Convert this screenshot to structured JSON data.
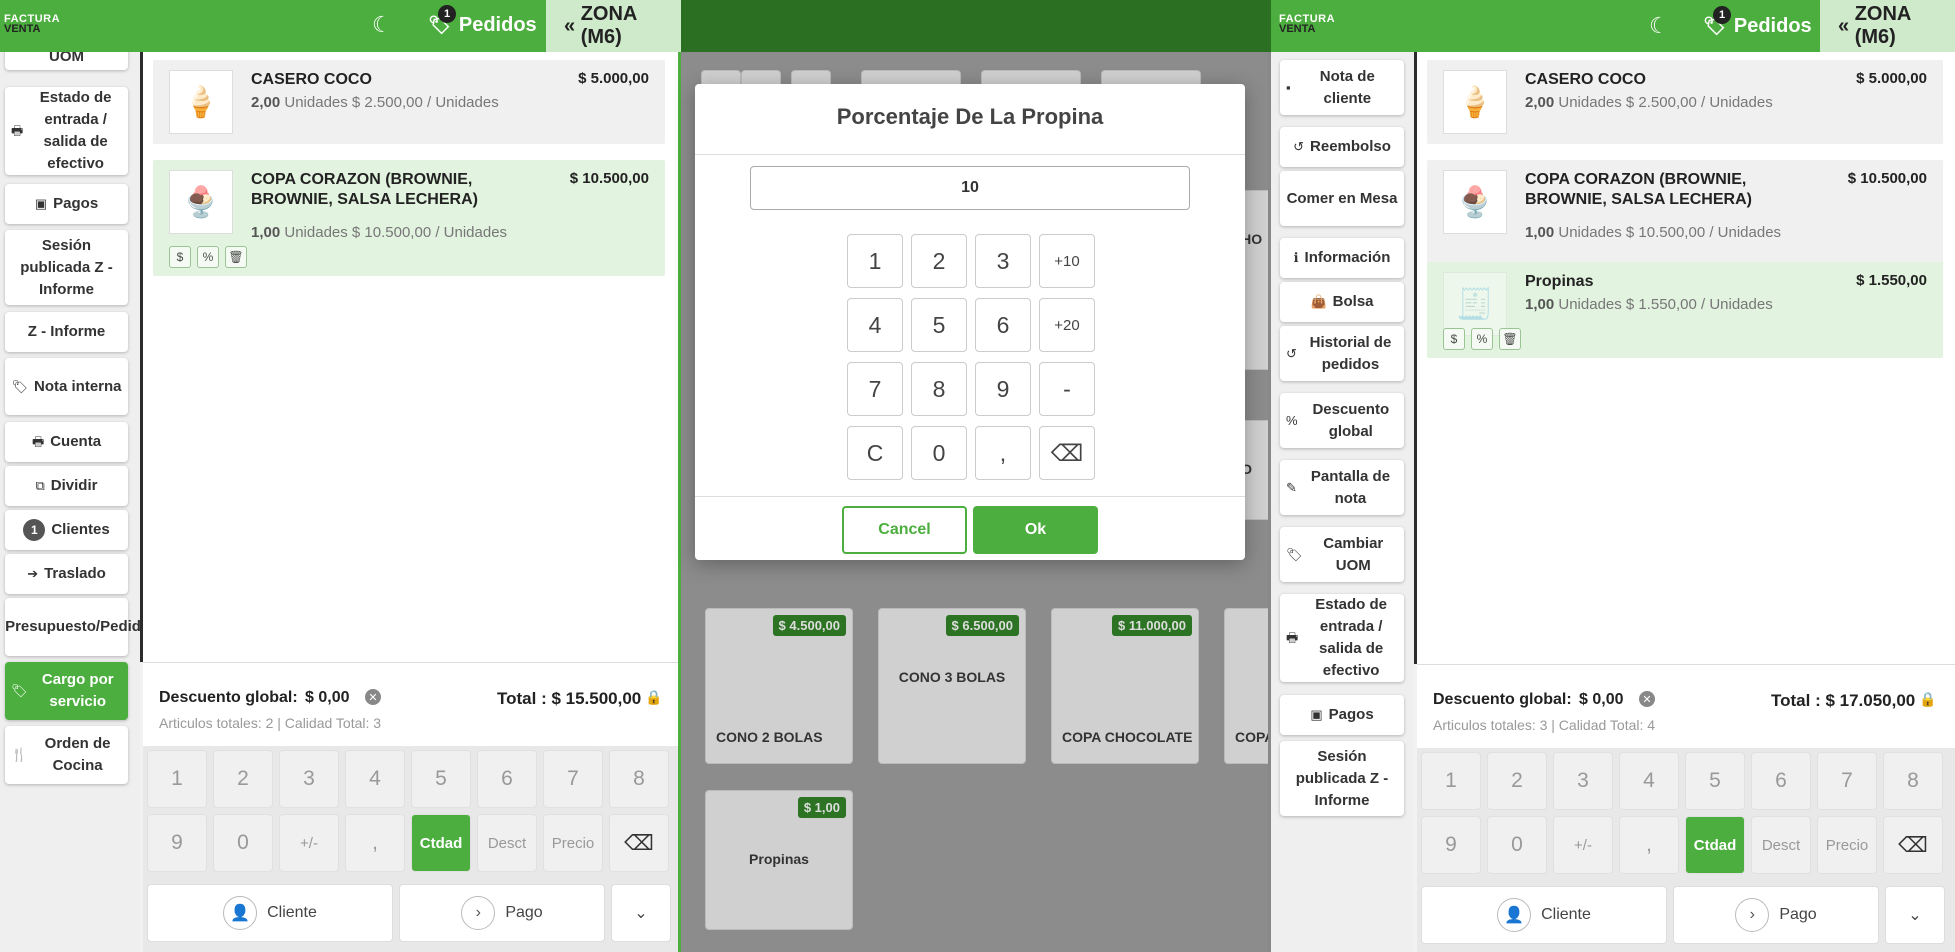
{
  "left": {
    "topbar": {
      "logo_line1": "FACTURA",
      "logo_line2": "VENTA",
      "orders_label": "Pedidos",
      "orders_badge": "1",
      "zone_label": "ZONA (M6)"
    },
    "sidebar": [
      {
        "label": "UOM",
        "icon": "chevron-down-icon"
      },
      {
        "label": "Estado de entrada / salida de efectivo",
        "icon": "printer-icon"
      },
      {
        "label": "Pagos",
        "icon": "money-icon"
      },
      {
        "label": "Sesión publicada Z - Informe",
        "icon": ""
      },
      {
        "label": "Z - Informe",
        "icon": ""
      },
      {
        "label": "Nota interna",
        "icon": "tag-icon"
      },
      {
        "label": "Cuenta",
        "icon": "printer-icon"
      },
      {
        "label": "Dividir",
        "icon": "split-icon"
      },
      {
        "label": "Clientes",
        "icon": "count-badge",
        "count": "1"
      },
      {
        "label": "Traslado",
        "icon": "arrow-right-icon"
      },
      {
        "label": "Presupuesto/Pedido",
        "icon": "link-icon"
      },
      {
        "label": "Cargo por servicio",
        "icon": "tag-icon"
      },
      {
        "label": "Orden de Cocina",
        "icon": "cutlery-icon"
      }
    ],
    "lines": [
      {
        "name": "CASERO COCO",
        "qty": "2,00",
        "detail": "Unidades $ 2.500,00 / Unidades",
        "price": "$ 5.000,00"
      },
      {
        "name": "COPA CORAZON (BROWNIE, BROWNIE, SALSA LECHERA)",
        "qty": "1,00",
        "detail": "Unidades $ 10.500,00 / Unidades",
        "price": "$ 10.500,00"
      }
    ],
    "summary": {
      "discount_label": "Descuento global:",
      "discount_value": "$ 0,00",
      "total": "Total : $ 15.500,00",
      "sub": "Articulos totales: 2  |  Calidad Total: 3"
    }
  },
  "right": {
    "topbar": {
      "logo_line1": "FACTURA",
      "logo_line2": "VENTA",
      "orders_label": "Pedidos",
      "orders_badge": "1",
      "zone_label": "ZONA (M6)"
    },
    "sidebar": [
      {
        "label": "Nota de cliente",
        "icon": "note-icon"
      },
      {
        "label": "Reembolso",
        "icon": "undo-icon"
      },
      {
        "label": "Comer en Mesa",
        "icon": ""
      },
      {
        "label": "Información",
        "icon": "info-icon"
      },
      {
        "label": "Bolsa",
        "icon": "bag-icon"
      },
      {
        "label": "Historial de pedidos",
        "icon": "history-icon"
      },
      {
        "label": "Descuento global",
        "icon": "percent-icon"
      },
      {
        "label": "Pantalla de nota",
        "icon": "edit-icon"
      },
      {
        "label": "Cambiar UOM",
        "icon": "tag-icon"
      },
      {
        "label": "Estado de entrada / salida de efectivo",
        "icon": "printer-icon"
      },
      {
        "label": "Pagos",
        "icon": "money-icon"
      },
      {
        "label": "Sesión publicada Z - Informe",
        "icon": ""
      }
    ],
    "lines": [
      {
        "name": "CASERO COCO",
        "qty": "2,00",
        "detail": "Unidades $ 2.500,00 / Unidades",
        "price": "$ 5.000,00"
      },
      {
        "name": "COPA CORAZON (BROWNIE, BROWNIE, SALSA LECHERA)",
        "qty": "1,00",
        "detail": "Unidades $ 10.500,00 / Unidades",
        "price": "$ 10.500,00"
      },
      {
        "name": "Propinas",
        "qty": "1,00",
        "detail": "Unidades $ 1.550,00 / Unidades",
        "price": "$ 1.550,00"
      }
    ],
    "summary": {
      "discount_label": "Descuento global:",
      "discount_value": "$ 0,00",
      "total": "Total : $ 17.050,00",
      "sub": "Articulos totales: 3  |  Calidad Total: 4"
    }
  },
  "numpad": {
    "row1": [
      "1",
      "2",
      "3",
      "4",
      "5",
      "6",
      "7",
      "8"
    ],
    "row2": [
      "9",
      "0",
      "+/-",
      ",",
      "Ctdad",
      "Desct",
      "Precio",
      "⌫"
    ],
    "customer": "Cliente",
    "payment": "Pago"
  },
  "products": [
    {
      "name": "CONO 2 BOLAS",
      "price": "$ 4.500,00"
    },
    {
      "name": "CONO 3 BOLAS",
      "price": "$ 6.500,00"
    },
    {
      "name": "COPA CHOCOLATE",
      "price": "$ 11.000,00"
    },
    {
      "name": "COPA",
      "price": ""
    },
    {
      "name": "Propinas",
      "price": "$ 1,00"
    },
    {
      "name": "CHO",
      "price": ""
    },
    {
      "name": "CO",
      "price": ""
    }
  ],
  "dialog": {
    "title": "Porcentaje De La Propina",
    "value": "10",
    "keys": [
      "1",
      "2",
      "3",
      "+10",
      "4",
      "5",
      "6",
      "+20",
      "7",
      "8",
      "9",
      "-",
      "C",
      "0",
      ",",
      "⌫"
    ],
    "cancel": "Cancel",
    "ok": "Ok"
  },
  "colors": {
    "brand": "#4cae3e",
    "zone": "#cfe9cb"
  }
}
